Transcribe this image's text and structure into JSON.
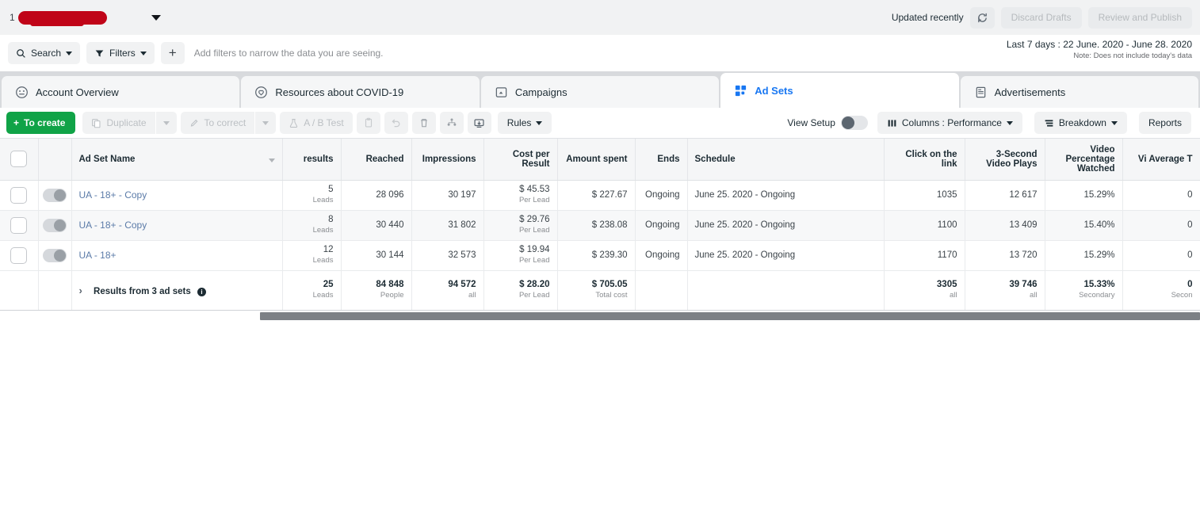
{
  "account_bar": {
    "account_number": "1",
    "account_name_redacted": "",
    "updated_label": "Updated recently",
    "refresh_icon": "refresh-icon",
    "discard_label": "Discard Drafts",
    "publish_label": "Review and Publish"
  },
  "filter_bar": {
    "search_label": "Search",
    "search_icon": "search-icon",
    "filters_label": "Filters",
    "filters_icon": "funnel-icon",
    "add_label": "+",
    "hint": "Add filters to narrow the data you are seeing.",
    "date_range": "Last 7 days : 22 June. 2020 - June 28. 2020",
    "date_note": "Note: Does not include today's data"
  },
  "tabs": [
    {
      "label": "Account Overview",
      "icon": "account-overview-icon",
      "active": false
    },
    {
      "label": "Resources about COVID-19",
      "icon": "shield-icon",
      "active": false
    },
    {
      "label": "Campaigns",
      "icon": "campaign-icon",
      "active": false
    },
    {
      "label": "Ad Sets",
      "icon": "adsets-grid-icon",
      "active": true
    },
    {
      "label": "Advertisements",
      "icon": "advertisement-icon",
      "active": false
    }
  ],
  "toolbar": {
    "create_label": "To create",
    "duplicate_label": "Duplicate",
    "duplicate_icon": "duplicate-icon",
    "correct_label": "To correct",
    "correct_icon": "pencil-icon",
    "abtest_label": "A / B Test",
    "abtest_icon": "flask-icon",
    "icons": [
      {
        "name": "clipboard-icon"
      },
      {
        "name": "undo-icon"
      },
      {
        "name": "trash-icon"
      },
      {
        "name": "audience-icon"
      },
      {
        "name": "export-icon"
      }
    ],
    "rules_label": "Rules",
    "view_setup_label": "View Setup",
    "view_setup_state": "off",
    "columns_label": "Columns : Performance",
    "columns_icon": "columns-icon",
    "breakdown_label": "Breakdown",
    "breakdown_icon": "breakdown-icon",
    "reports_label": "Reports"
  },
  "table": {
    "columns": [
      {
        "key": "name",
        "label": "Ad Set Name",
        "align": "lft"
      },
      {
        "key": "results",
        "label": "results",
        "align": "num"
      },
      {
        "key": "reached",
        "label": "Reached",
        "align": "num"
      },
      {
        "key": "impressions",
        "label": "Impressions",
        "align": "num"
      },
      {
        "key": "cpr",
        "label": "Cost per Result",
        "align": "num"
      },
      {
        "key": "spent",
        "label": "Amount spent",
        "align": "num"
      },
      {
        "key": "ends",
        "label": "Ends",
        "align": "num"
      },
      {
        "key": "schedule",
        "label": "Schedule",
        "align": "lft"
      },
      {
        "key": "clicks",
        "label": "Click on the link",
        "align": "num"
      },
      {
        "key": "plays",
        "label": "3-Second Video Plays",
        "align": "num"
      },
      {
        "key": "vpw",
        "label": "Video Percentage Watched",
        "align": "num"
      },
      {
        "key": "vavg",
        "label": "Vi Average T",
        "align": "num"
      }
    ],
    "rows": [
      {
        "name": "UA - 18+ - Copy",
        "results": "5",
        "results_sub": "Leads",
        "reached": "28 096",
        "impressions": "30 197",
        "cpr": "$ 45.53",
        "cpr_sub": "Per Lead",
        "spent": "$ 227.67",
        "ends": "Ongoing",
        "schedule": "June 25. 2020 - Ongoing",
        "clicks": "1035",
        "plays": "12 617",
        "vpw": "15.29%",
        "vavg": "0"
      },
      {
        "name": "UA - 18+ - Copy",
        "results": "8",
        "results_sub": "Leads",
        "reached": "30 440",
        "impressions": "31 802",
        "cpr": "$ 29.76",
        "cpr_sub": "Per Lead",
        "spent": "$ 238.08",
        "ends": "Ongoing",
        "schedule": "June 25. 2020 - Ongoing",
        "clicks": "1100",
        "plays": "13 409",
        "vpw": "15.40%",
        "vavg": "0"
      },
      {
        "name": "UA - 18+",
        "results": "12",
        "results_sub": "Leads",
        "reached": "30 144",
        "impressions": "32 573",
        "cpr": "$ 19.94",
        "cpr_sub": "Per Lead",
        "spent": "$ 239.30",
        "ends": "Ongoing",
        "schedule": "June 25. 2020 - Ongoing",
        "clicks": "1170",
        "plays": "13 720",
        "vpw": "15.29%",
        "vavg": "0"
      }
    ],
    "summary": {
      "name": "Results from 3 ad sets",
      "results": "25",
      "results_sub": "Leads",
      "reached": "84 848",
      "reached_sub": "People",
      "impressions": "94 572",
      "impressions_sub": "all",
      "cpr": "$ 28.20",
      "cpr_sub": "Per Lead",
      "spent": "$ 705.05",
      "spent_sub": "Total cost",
      "ends": "",
      "schedule": "",
      "clicks": "3305",
      "clicks_sub": "all",
      "plays": "39 746",
      "plays_sub": "all",
      "vpw": "15.33%",
      "vpw_sub": "Secondary",
      "vavg": "0",
      "vavg_sub": "Secon"
    }
  },
  "colors": {
    "accent_blue": "#1877f2",
    "create_green": "#10a347",
    "link_blue": "#5b7ba8",
    "redaction_red": "#c00418"
  }
}
